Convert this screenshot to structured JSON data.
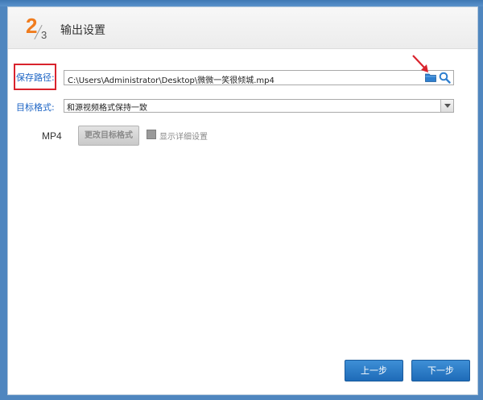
{
  "header": {
    "step_current": "2",
    "step_total": "3",
    "title": "输出设置"
  },
  "save_path": {
    "label": "保存路径:",
    "value": "C:\\Users\\Administrator\\Desktop\\微微一笑很倾城.mp4"
  },
  "target_format": {
    "label": "目标格式:",
    "selected": "和源视频格式保持一致"
  },
  "format_info": {
    "name": "MP4",
    "change_button": "更改目标格式",
    "detail_checkbox_label": "显示详细设置"
  },
  "footer": {
    "prev_label": "上一步",
    "next_label": "下一步"
  },
  "colors": {
    "accent_orange": "#f07c1e",
    "label_blue": "#1b63c4",
    "highlight_red": "#d9232d",
    "button_blue": "#1e6bb8"
  }
}
